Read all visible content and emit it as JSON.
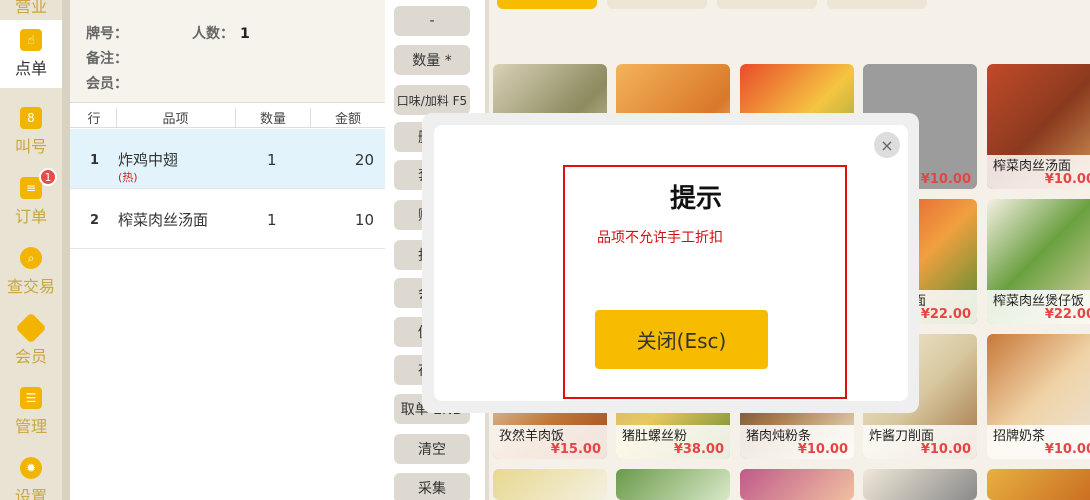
{
  "nav": {
    "items": [
      {
        "label": "营业",
        "icon": "store-icon"
      },
      {
        "label": "点单",
        "icon": "tap-hand-icon"
      },
      {
        "label": "叫号",
        "icon": "number-ticket-icon"
      },
      {
        "label": "订单",
        "icon": "order-list-icon",
        "badge": "1"
      },
      {
        "label": "查交易",
        "icon": "search-icon"
      },
      {
        "label": "会员",
        "icon": "diamond-icon"
      },
      {
        "label": "管理",
        "icon": "checklist-icon"
      },
      {
        "label": "设置",
        "icon": "gear-icon"
      }
    ]
  },
  "order": {
    "plate_label": "牌号：",
    "people_label": "人数：",
    "people_value": "1",
    "note_label": "备注：",
    "member_label": "会员：",
    "columns": [
      "行",
      "品项",
      "数量",
      "金额"
    ],
    "rows": [
      {
        "index": "1",
        "name": "炸鸡中翅",
        "sub": "(热)",
        "qty": "1",
        "amount": "20"
      },
      {
        "index": "2",
        "name": "榨菜肉丝汤面",
        "sub": "",
        "qty": "1",
        "amount": "10"
      }
    ]
  },
  "actions": [
    "-",
    "数量 *",
    "口味/加料 F5",
    "删除",
    "套餐",
    "赠送",
    "折扣",
    "会员",
    "促销",
    "存单",
    "取单 END",
    "清空",
    "采集"
  ],
  "products": [
    {
      "name": "",
      "price": ""
    },
    {
      "name": "",
      "price": ""
    },
    {
      "name": "",
      "price": ""
    },
    {
      "name": "",
      "price": "¥10.00"
    },
    {
      "name": "榨菜肉丝汤面",
      "price": "¥10.00"
    },
    {
      "name": "",
      "price": ""
    },
    {
      "name": "",
      "price": ""
    },
    {
      "name": "",
      "price": ""
    },
    {
      "name": "面",
      "price": "¥22.00"
    },
    {
      "name": "榨菜肉丝煲仔饭",
      "price": "¥22.00"
    },
    {
      "name": "孜然羊肉饭",
      "price": "¥15.00"
    },
    {
      "name": "猪肚螺丝粉",
      "price": "¥38.00"
    },
    {
      "name": "猪肉炖粉条",
      "price": "¥10.00"
    },
    {
      "name": "炸酱刀削面",
      "price": "¥10.00"
    },
    {
      "name": "招牌奶茶",
      "price": "¥10.00"
    }
  ],
  "modal": {
    "title": "提示",
    "message": "品项不允许手工折扣",
    "close_button": "关闭(Esc)",
    "close_icon": "×"
  },
  "colors": {
    "accent": "#f7bc00",
    "price": "#e64545",
    "alert": "#d01010"
  }
}
